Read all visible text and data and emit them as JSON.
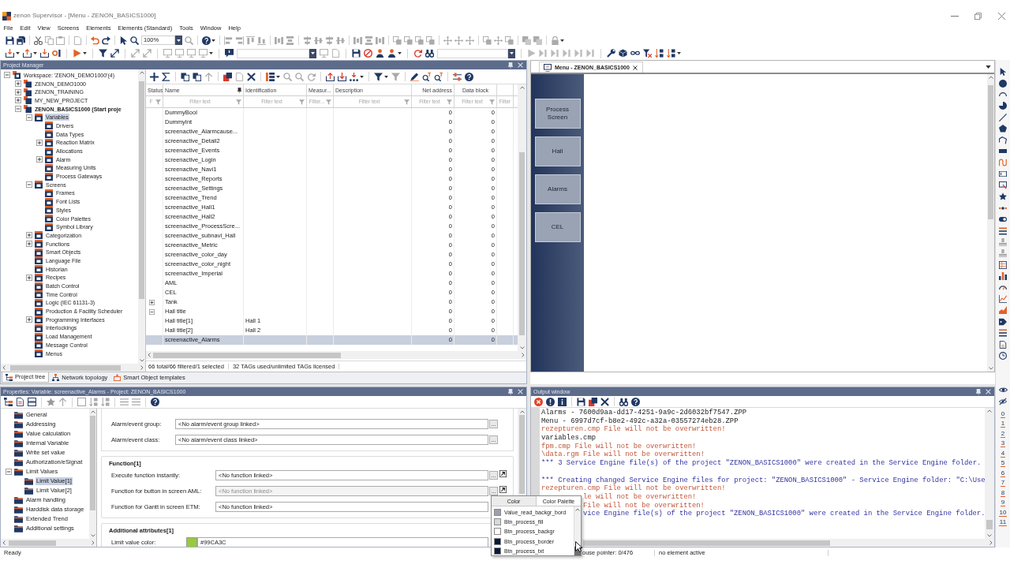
{
  "window": {
    "title": "zenon Supervisor - [Menu - ZENON_BASICS1000]"
  },
  "menu": [
    "File",
    "Edit",
    "View",
    "Screens",
    "Elements",
    "Elements (Standard)",
    "Tools",
    "Window",
    "Help"
  ],
  "toolbar": {
    "zoom": "100%"
  },
  "project_manager": {
    "title": "Project Manager",
    "tree": [
      {
        "label": "Workspace: 'ZENON_DEMO1000'(4)",
        "kind": "workspace",
        "expanded": true,
        "selected": false,
        "children": [
          {
            "label": "ZENON_DEMO1000",
            "kind": "project",
            "active": false,
            "expanded": false,
            "selected": false
          },
          {
            "label": "ZENON_TRAINING",
            "kind": "project",
            "active": false,
            "expanded": false,
            "selected": false
          },
          {
            "label": "MY_NEW_PROJECT",
            "kind": "project",
            "active": false,
            "expanded": false,
            "selected": false
          },
          {
            "label": "ZENON_BASICS1000 (Start proje",
            "kind": "project",
            "active": true,
            "expanded": true,
            "selected": false,
            "children": [
              {
                "label": "Variables",
                "kind": "module",
                "expanded": true,
                "selected": true,
                "children": [
                  {
                    "label": "Drivers",
                    "kind": "module",
                    "selected": false
                  },
                  {
                    "label": "Data Types",
                    "kind": "module",
                    "selected": false
                  },
                  {
                    "label": "Reaction Matrix",
                    "kind": "module",
                    "expanded": false,
                    "selected": false
                  },
                  {
                    "label": "Allocations",
                    "kind": "module",
                    "selected": false
                  },
                  {
                    "label": "Alarm",
                    "kind": "module",
                    "expanded": false,
                    "selected": false
                  },
                  {
                    "label": "Measuring Units",
                    "kind": "module",
                    "selected": false
                  },
                  {
                    "label": "Process Gateways",
                    "kind": "module",
                    "selected": false
                  }
                ]
              },
              {
                "label": "Screens",
                "kind": "module",
                "expanded": true,
                "selected": false,
                "children": [
                  {
                    "label": "Frames",
                    "kind": "module",
                    "selected": false
                  },
                  {
                    "label": "Font Lists",
                    "kind": "module",
                    "selected": false
                  },
                  {
                    "label": "Styles",
                    "kind": "module",
                    "selected": false
                  },
                  {
                    "label": "Color Palettes",
                    "kind": "module",
                    "selected": false
                  },
                  {
                    "label": "Symbol Library",
                    "kind": "module",
                    "selected": false
                  }
                ]
              },
              {
                "label": "Categorization",
                "kind": "module",
                "expanded": false,
                "selected": false
              },
              {
                "label": "Functions",
                "kind": "module",
                "expanded": false,
                "selected": false
              },
              {
                "label": "Smart Objects",
                "kind": "module",
                "selected": false
              },
              {
                "label": "Language File",
                "kind": "module",
                "selected": false
              },
              {
                "label": "Historian",
                "kind": "module",
                "selected": false
              },
              {
                "label": "Recipes",
                "kind": "module",
                "expanded": false,
                "selected": false
              },
              {
                "label": "Batch Control",
                "kind": "module",
                "selected": false
              },
              {
                "label": "Time Control",
                "kind": "module",
                "selected": false
              },
              {
                "label": "Logic (IEC 61131-3)",
                "kind": "module",
                "selected": false
              },
              {
                "label": "Production & Facility Scheduler",
                "kind": "module",
                "selected": false
              },
              {
                "label": "Programming Interfaces",
                "kind": "module",
                "expanded": false,
                "selected": false
              },
              {
                "label": "Interlockings",
                "kind": "module",
                "selected": false
              },
              {
                "label": "Load Management",
                "kind": "module",
                "selected": false
              },
              {
                "label": "Message Control",
                "kind": "module",
                "selected": false
              },
              {
                "label": "Menus",
                "kind": "module",
                "selected": false
              }
            ]
          }
        ]
      }
    ],
    "variables": {
      "columns": [
        "Status",
        "Name",
        "Identification",
        "Measur...",
        "Description",
        "Net address",
        "Data block"
      ],
      "filters": [
        "F",
        "Filter text",
        "Filter text",
        "Filter...",
        "Filter text",
        "Filter text",
        "Filter text",
        "Filter"
      ],
      "rows": [
        {
          "name": "DummyBool",
          "net_address": "0",
          "data_block": "0",
          "selected": false
        },
        {
          "name": "DummyInt",
          "net_address": "0",
          "data_block": "0",
          "selected": false
        },
        {
          "name": "screenactive_Alarmcause...",
          "net_address": "0",
          "data_block": "0",
          "selected": false
        },
        {
          "name": "screenactive_Detail2",
          "net_address": "0",
          "data_block": "0",
          "selected": false
        },
        {
          "name": "screenactive_Events",
          "net_address": "0",
          "data_block": "0",
          "selected": false
        },
        {
          "name": "screenactive_Login",
          "net_address": "0",
          "data_block": "0",
          "selected": false
        },
        {
          "name": "screenactive_Navi1",
          "net_address": "0",
          "data_block": "0",
          "selected": false
        },
        {
          "name": "screenactive_Reports",
          "net_address": "0",
          "data_block": "0",
          "selected": false
        },
        {
          "name": "screenactive_Settings",
          "net_address": "0",
          "data_block": "0",
          "selected": false
        },
        {
          "name": "screenactive_Trend",
          "net_address": "0",
          "data_block": "0",
          "selected": false
        },
        {
          "name": "screenactive_Hall1",
          "net_address": "0",
          "data_block": "0",
          "selected": false
        },
        {
          "name": "screenactive_Hall2",
          "net_address": "0",
          "data_block": "0",
          "selected": false
        },
        {
          "name": "screenactive_ProcessScre...",
          "net_address": "0",
          "data_block": "0",
          "selected": false
        },
        {
          "name": "screenactive_subnavi_Hall",
          "net_address": "0",
          "data_block": "0",
          "selected": false
        },
        {
          "name": "screenactive_Metric",
          "net_address": "0",
          "data_block": "0",
          "selected": false
        },
        {
          "name": "screenactive_color_day",
          "net_address": "0",
          "data_block": "0",
          "selected": false
        },
        {
          "name": "screenactive_color_night",
          "net_address": "0",
          "data_block": "0",
          "selected": false
        },
        {
          "name": "screenactive_Imperial",
          "net_address": "0",
          "data_block": "0",
          "selected": false
        },
        {
          "name": "AML",
          "net_address": "0",
          "data_block": "0",
          "selected": false
        },
        {
          "name": "CEL",
          "net_address": "0",
          "data_block": "0",
          "selected": false
        },
        {
          "name": "Tank",
          "net_address": "0",
          "data_block": "0",
          "expanded": false,
          "selected": false
        },
        {
          "name": "Hall title",
          "net_address": "0",
          "data_block": "0",
          "expanded": true,
          "selected": false,
          "children": [
            {
              "name": "Hall title[1]",
              "identification": "Hall 1",
              "net_address": "0",
              "data_block": "0",
              "selected": false
            },
            {
              "name": "Hall title[2]",
              "identification": "Hall 2",
              "net_address": "0",
              "data_block": "0",
              "selected": false
            }
          ]
        },
        {
          "name": "screenactive_Alarms",
          "net_address": "0",
          "data_block": "0",
          "selected": true
        }
      ],
      "summary": "66 total/66 filtered/1 selected",
      "license": "32 TAGs used/unlimited TAGs licensed"
    },
    "tabs": [
      {
        "label": "Project tree",
        "selected": true
      },
      {
        "label": "Network topology",
        "selected": false
      },
      {
        "label": "Smart Object templates",
        "selected": false
      }
    ]
  },
  "editor": {
    "tab": "Menu - ZENON_BASICS1000",
    "buttons": [
      "Process Screen",
      "Hall",
      "Alarms",
      "CEL"
    ],
    "layers": [
      "0",
      "1",
      "2",
      "3",
      "4",
      "5",
      "6",
      "7",
      "8",
      "9",
      "10",
      "11"
    ]
  },
  "properties": {
    "title": "Properties: Variable: screenactive_Alarms - Project: ZENON_BASICS1000",
    "tree": [
      {
        "label": "General",
        "selected": false
      },
      {
        "label": "Addressing",
        "selected": false
      },
      {
        "label": "Value calculation",
        "selected": false
      },
      {
        "label": "Internal Variable",
        "selected": false
      },
      {
        "label": "Write set value",
        "selected": false
      },
      {
        "label": "Authorization/eSignat",
        "selected": false
      },
      {
        "label": "Limit Values",
        "expanded": true,
        "selected": false,
        "children": [
          {
            "label": "Limit Value[1]",
            "selected": true
          },
          {
            "label": "Limit Value[2]",
            "selected": false
          }
        ]
      },
      {
        "label": "Alarm handling",
        "selected": false
      },
      {
        "label": "Harddisk data storage",
        "selected": false
      },
      {
        "label": "Extended Trend",
        "selected": false
      },
      {
        "label": "Additional settings",
        "selected": false
      }
    ],
    "groups": [
      {
        "fields": [
          {
            "kind": "link",
            "label": "Alarm/event group:",
            "value": "<No alarm/event group linked>",
            "disabled": false,
            "button": "..."
          },
          {
            "kind": "link",
            "label": "Alarm/event class:",
            "value": "<No alarm/event class linked>",
            "disabled": false,
            "button": "..."
          }
        ]
      },
      {
        "title": "Function[1]",
        "fields": [
          {
            "kind": "function",
            "label": "Execute function instantly:",
            "value": "<No function linked>",
            "disabled": false,
            "button": "..."
          },
          {
            "kind": "function",
            "label": "Function for button in screen AML:",
            "value": "<No function linked>",
            "disabled": true,
            "button": "..."
          },
          {
            "kind": "function",
            "label": "Function for Gantt in screen ETM:",
            "value": "<No function linked>",
            "disabled": false
          }
        ]
      },
      {
        "title": "Additional attributes[1]",
        "fields": [
          {
            "kind": "color",
            "label": "Limit value color:",
            "value": "#99CA3C",
            "color": "#99ca3c",
            "disabled": false
          }
        ]
      }
    ]
  },
  "output": {
    "title": "Output window",
    "blocks": [
      {
        "lines": [
          {
            "text": "Alarms - 7600d9aa-dd17-4251-9a9c-2d6032bf7547.ZPP",
            "kind": "plain"
          },
          {
            "text": "Menu - 6997d7cf-b8e2-492c-a32a-03557274eb28.ZPP",
            "kind": "plain"
          },
          {
            "text": "rezepturen.cmp File will not be overwritten!",
            "kind": "warning"
          },
          {
            "text": "variables.cmp",
            "kind": "plain"
          },
          {
            "text": "fpm.cmp File will not be overwritten!",
            "kind": "warning"
          },
          {
            "text": "\\data.rgm File will not be overwritten!",
            "kind": "warning"
          },
          {
            "text": "*** 3 Service Engine file(s) of the project \"ZENON_BASICS1000\" were created in the Service Engine folder.",
            "kind": "summary"
          }
        ]
      },
      {
        "lines": [
          {
            "text": "*** Creating changed Service Engine files for project: \"ZENON_BASICS1000\" - Service Engine folder: \"C:\\Use",
            "kind": "summary"
          },
          {
            "text": "rezepturen.cmp File will not be overwritten!",
            "kind": "warning"
          },
          {
            "text": "le will not be overwritten!",
            "kind": "warning",
            "covered": true
          },
          {
            "text": "File will not be overwritten!",
            "kind": "warning",
            "covered": true
          },
          {
            "text": "vice Engine file(s) of the project \"ZENON_BASICS1000\" were created in the Service Engine folder.",
            "kind": "summary",
            "covered": true
          }
        ]
      }
    ]
  },
  "color_picker": {
    "tabs": [
      {
        "label": "Color",
        "selected": false
      },
      {
        "label": "Color Palette",
        "selected": true
      }
    ],
    "items": [
      {
        "label": "Value_read_backgr_bord",
        "color": "#9aa0ad"
      },
      {
        "label": "Btn_process_fill",
        "color": "#d6d8dc"
      },
      {
        "label": "Btn_process_backgr",
        "color": "#ffffff"
      },
      {
        "label": "Btn_process_border",
        "color": "#0b1a3c"
      },
      {
        "label": "Btn_process_txt",
        "color": "#0b1a3c"
      }
    ]
  },
  "status_bar": {
    "message": "Ready",
    "mouse_position": "ouse pointer: 0/476",
    "selection": "no element active"
  }
}
